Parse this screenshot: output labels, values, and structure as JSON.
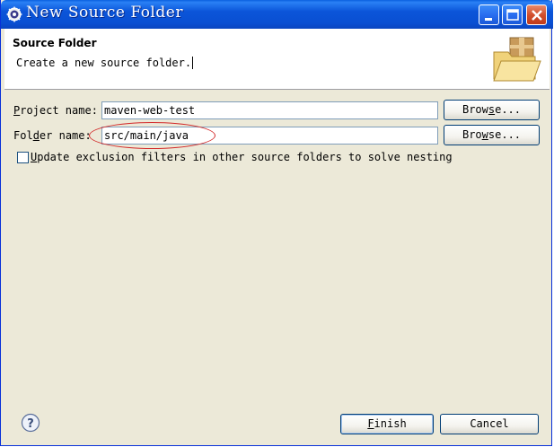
{
  "window": {
    "title": "New Source Folder",
    "controls": {
      "minimize": "minimize-icon",
      "maximize": "maximize-icon",
      "close": "close-icon"
    }
  },
  "header": {
    "title": "Source Folder",
    "description": "Create a new source folder."
  },
  "form": {
    "project": {
      "label_prefix": "",
      "label_mnemonic": "P",
      "label_suffix": "roject name:",
      "value": "maven-web-test",
      "browse_prefix": "Brow",
      "browse_mnemonic": "s",
      "browse_suffix": "e..."
    },
    "folder": {
      "label_prefix": "Fol",
      "label_mnemonic": "d",
      "label_suffix": "er name:",
      "value": "src/main/java",
      "browse_prefix": "Bro",
      "browse_mnemonic": "w",
      "browse_suffix": "se..."
    },
    "update_checkbox": {
      "label_mnemonic": "U",
      "label_suffix": "pdate exclusion filters in other source folders to solve nesting",
      "checked": false
    }
  },
  "footer": {
    "help_icon": "help-icon",
    "finish_mnemonic": "F",
    "finish_suffix": "inish",
    "cancel": "Cancel"
  },
  "colors": {
    "titlebar": "#0a55d9",
    "annotation": "#d22a2a",
    "dialog_bg": "#ece9d8"
  }
}
